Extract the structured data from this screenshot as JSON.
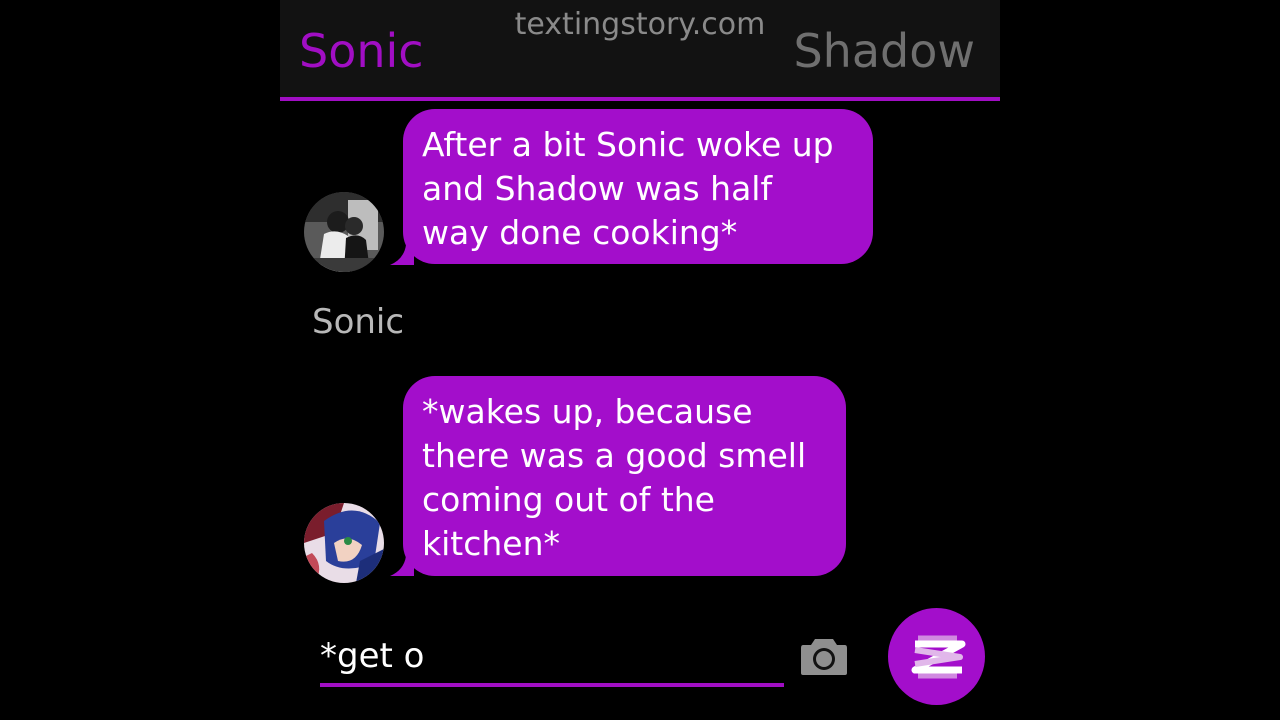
{
  "header": {
    "left_contact": "Sonic",
    "right_contact": "Shadow",
    "watermark": "textingstory.com"
  },
  "messages": [
    {
      "text": "After a bit Sonic woke up\nand Shadow was half\nway done cooking*",
      "avatar_icon": "couple-avatar-icon"
    },
    {
      "sender": "Sonic",
      "text": "*wakes up, because\nthere was a good smell\ncoming out of the\nkitchen*",
      "avatar_icon": "sonic-avatar-icon"
    }
  ],
  "composer": {
    "input_value": "*get o",
    "camera_icon": "camera-icon",
    "send_icon": "send-icon"
  },
  "colors": {
    "accent": "#a30ecb",
    "header_bg": "#121212",
    "inactive_tab": "#6f6f6f",
    "background": "#000000"
  }
}
